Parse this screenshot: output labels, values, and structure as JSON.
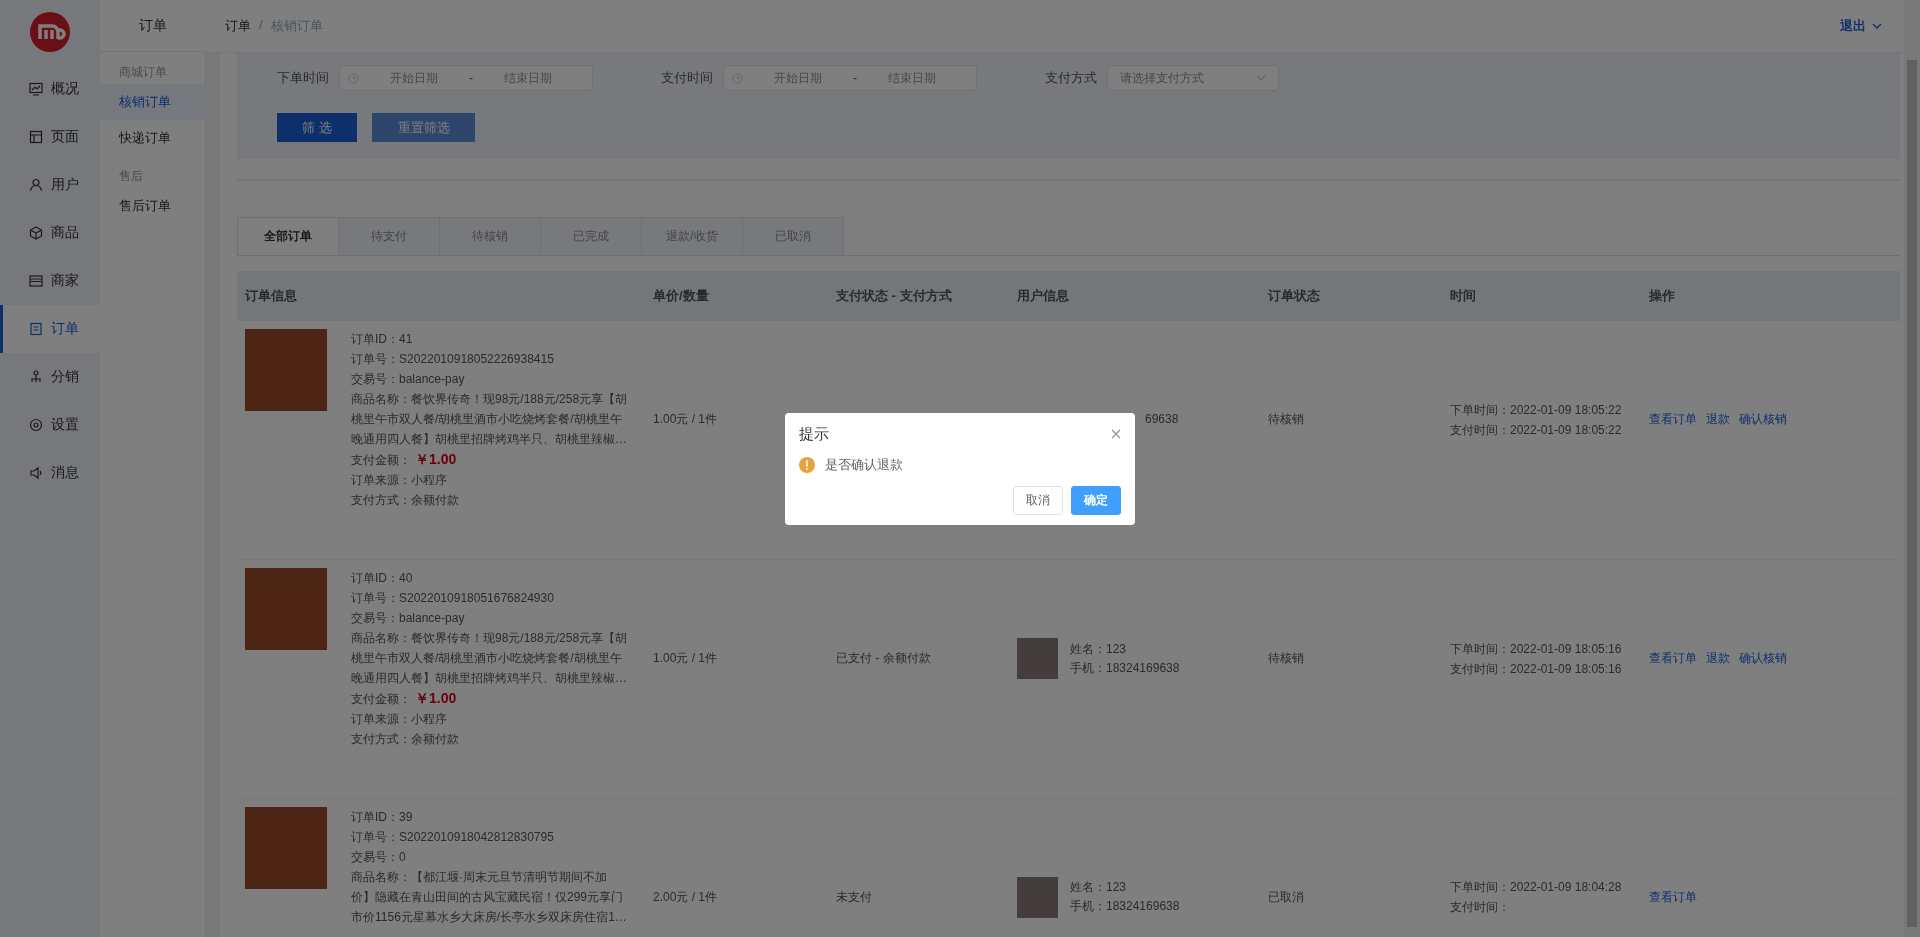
{
  "sidebar": {
    "items": [
      {
        "label": "概况",
        "selected": false
      },
      {
        "label": "页面",
        "selected": false
      },
      {
        "label": "用户",
        "selected": false
      },
      {
        "label": "商品",
        "selected": false
      },
      {
        "label": "商家",
        "selected": false
      },
      {
        "label": "订单",
        "selected": true
      },
      {
        "label": "分销",
        "selected": false
      },
      {
        "label": "设置",
        "selected": false
      },
      {
        "label": "消息",
        "selected": false
      }
    ]
  },
  "subnav": {
    "title": "订单",
    "groups": [
      {
        "label": "商城订单",
        "items": [
          {
            "label": "核销订单",
            "selected": true
          },
          {
            "label": "快递订单",
            "selected": false
          }
        ]
      },
      {
        "label": "售后",
        "items": [
          {
            "label": "售后订单",
            "selected": false
          }
        ]
      }
    ]
  },
  "header": {
    "breadcrumb": [
      "订单",
      "核销订单"
    ],
    "separator": "/",
    "user_menu": "退出"
  },
  "filters": {
    "fields": [
      {
        "kind": "daterange",
        "label": "下单时间",
        "start_placeholder": "开始日期",
        "separator": "-",
        "end_placeholder": "结束日期"
      },
      {
        "kind": "daterange",
        "label": "支付时间",
        "start_placeholder": "开始日期",
        "separator": "-",
        "end_placeholder": "结束日期"
      },
      {
        "kind": "select",
        "label": "支付方式",
        "placeholder": "请选择支付方式"
      }
    ],
    "buttons": [
      {
        "label": "筛 选",
        "kind": "primary"
      },
      {
        "label": "重置筛选",
        "kind": "secondary"
      }
    ]
  },
  "tabs": [
    {
      "label": "全部订单",
      "selected": true
    },
    {
      "label": "待支付",
      "selected": false
    },
    {
      "label": "待核销",
      "selected": false
    },
    {
      "label": "已完成",
      "selected": false
    },
    {
      "label": "退款/收货",
      "selected": false
    },
    {
      "label": "已取消",
      "selected": false
    }
  ],
  "table": {
    "columns": [
      "订单信息",
      "单价/数量",
      "支付状态 - 支付方式",
      "用户信息",
      "订单状态",
      "时间",
      "操作"
    ],
    "rows": [
      {
        "info": [
          {
            "kind": "text",
            "text": "订单ID：41"
          },
          {
            "kind": "text",
            "text": "订单号：S2022010918052226938415"
          },
          {
            "kind": "text",
            "text": "交易号：balance-pay"
          },
          {
            "kind": "text",
            "text": "商品名称：餐饮界传奇！现98元/188元/258元享【胡桃里午市双人餐/胡桃里酒市小吃烧烤套餐/胡桃里午晚通用四人餐】胡桃里招牌烤鸡半只、胡桃里辣椒…"
          },
          {
            "kind": "amount",
            "label": "支付金额：",
            "value": "￥1.00"
          },
          {
            "kind": "text",
            "text": "订单来源：小程序"
          },
          {
            "kind": "text",
            "text": "支付方式：余额付款"
          }
        ],
        "price": "1.00元 / 1件",
        "user": {
          "has_avatar": false,
          "phone": "69638"
        },
        "status": "待核销",
        "times": [
          "下单时间：2022-01-09 18:05:22",
          "支付时间：2022-01-09 18:05:22"
        ],
        "actions": [
          "查看订单",
          "退款",
          "确认核销"
        ]
      },
      {
        "info": [
          {
            "kind": "text",
            "text": "订单ID：40"
          },
          {
            "kind": "text",
            "text": "订单号：S2022010918051676824930"
          },
          {
            "kind": "text",
            "text": "交易号：balance-pay"
          },
          {
            "kind": "text",
            "text": "商品名称：餐饮界传奇！现98元/188元/258元享【胡桃里午市双人餐/胡桃里酒市小吃烧烤套餐/胡桃里午晚通用四人餐】胡桃里招牌烤鸡半只、胡桃里辣椒…"
          },
          {
            "kind": "amount",
            "label": "支付金额：",
            "value": "￥1.00"
          },
          {
            "kind": "text",
            "text": "订单来源：小程序"
          },
          {
            "kind": "text",
            "text": "支付方式：余额付款"
          }
        ],
        "price": "1.00元 / 1件",
        "payment": "已支付 - 余额付款",
        "user": {
          "has_avatar": true,
          "name": "姓名：123",
          "phone": "手机：18324169638"
        },
        "status": "待核销",
        "times": [
          "下单时间：2022-01-09 18:05:16",
          "支付时间：2022-01-09 18:05:16"
        ],
        "actions": [
          "查看订单",
          "退款",
          "确认核销"
        ]
      },
      {
        "info": [
          {
            "kind": "text",
            "text": "订单ID：39"
          },
          {
            "kind": "text",
            "text": "订单号：S2022010918042812830795"
          },
          {
            "kind": "text",
            "text": "交易号：0"
          },
          {
            "kind": "text",
            "text": "商品名称：【都江堰·周末元旦节清明节期间不加价】隐藏在青山田间的古风宝藏民宿！仅299元享门市价1156元星幕水乡大床房/长亭水乡双床房住宿1…"
          }
        ],
        "price": "2.00元 / 1件",
        "payment": "未支付",
        "user": {
          "has_avatar": true,
          "name": "姓名：123",
          "phone": "手机：18324169638"
        },
        "status": "已取消",
        "times": [
          "下单时间：2022-01-09 18:04:28",
          "支付时间："
        ],
        "actions": [
          "查看订单"
        ]
      }
    ]
  },
  "dialog": {
    "title": "提示",
    "message": "是否确认退款",
    "buttons": [
      {
        "label": "取消",
        "kind": "default"
      },
      {
        "label": "确定",
        "kind": "primary"
      }
    ]
  }
}
